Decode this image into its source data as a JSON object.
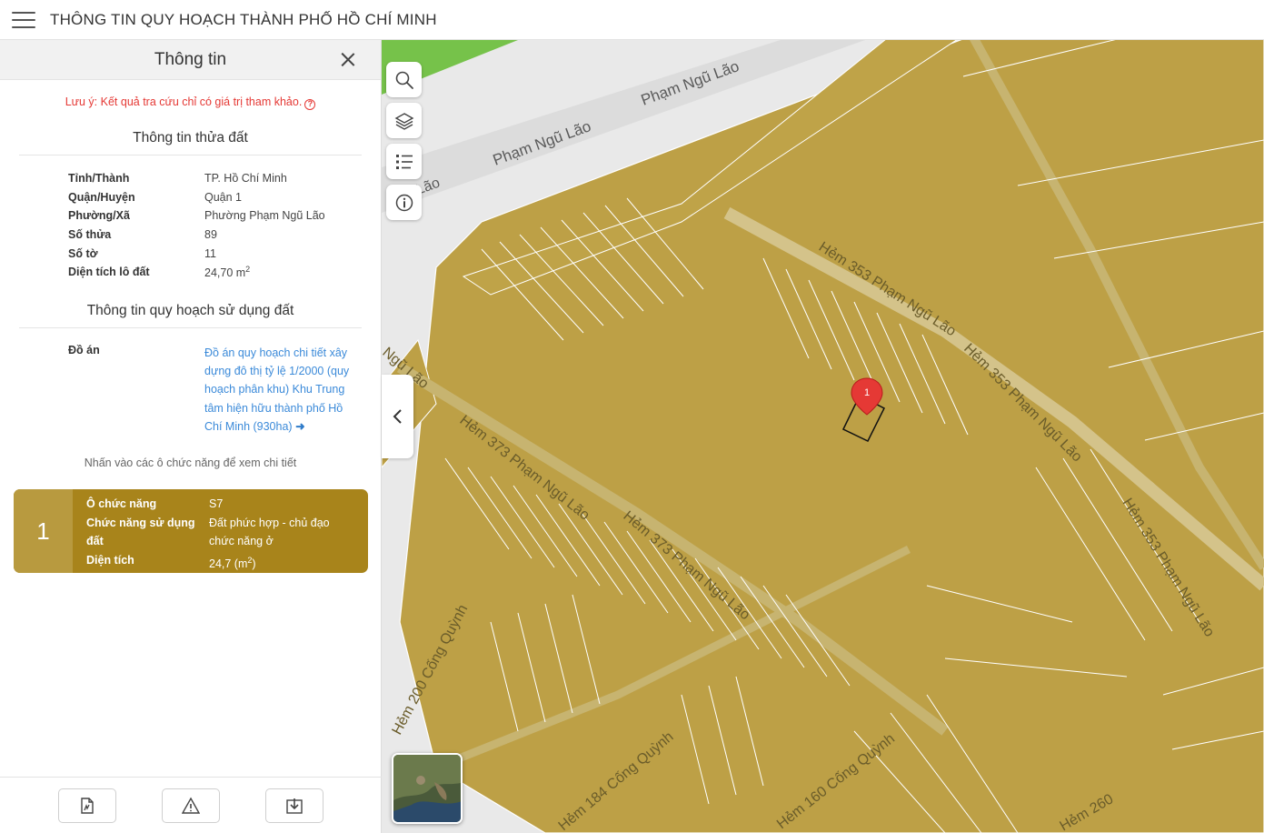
{
  "app": {
    "title": "THÔNG TIN QUY HOẠCH THÀNH PHỐ HỒ CHÍ MINH"
  },
  "panel": {
    "title": "Thông tin",
    "note": "Lưu ý: Kết quả tra cứu chỉ có giá trị tham khảo.",
    "parcel_section_title": "Thông tin thửa đất",
    "parcel_info": [
      {
        "key": "Tỉnh/Thành",
        "value": "TP. Hồ Chí Minh"
      },
      {
        "key": "Quận/Huyện",
        "value": "Quận 1"
      },
      {
        "key": "Phường/Xã",
        "value": "Phường Phạm Ngũ Lão"
      },
      {
        "key": "Số thửa",
        "value": "89"
      },
      {
        "key": "Số tờ",
        "value": "11"
      },
      {
        "key": "Diện tích lô đất",
        "value": "24,70 m",
        "sup": "2"
      }
    ],
    "plan_section_title": "Thông tin quy hoạch sử dụng đất",
    "plan_key": "Đồ án",
    "plan_value": "Đồ án quy hoạch chi tiết xây dựng đô thị tỷ lệ 1/2000 (quy hoạch phân khu) Khu Trung tâm hiện hữu thành phố Hồ Chí Minh (930ha)",
    "hint": "Nhấn vào các ô chức năng để xem chi tiết",
    "function_card": {
      "number": "1",
      "rows": [
        {
          "key": "Ô chức năng",
          "value": "S7"
        },
        {
          "key": "Chức năng sử dụng đất",
          "value": "Đất phức hợp - chủ đạo chức năng ở"
        },
        {
          "key": "Diện tích",
          "value": "24,7 (m",
          "sup": "2",
          "tail": ")"
        }
      ]
    }
  },
  "map": {
    "marker_label": "1",
    "street_labels": [
      {
        "text": "Phạm Ngũ Lão"
      },
      {
        "text": "Phạm Ngũ Lão"
      },
      {
        "text": "Hẻm 353 Phạm Ngũ Lão"
      },
      {
        "text": "Hẻm 353 Phạm Ngũ Lão"
      },
      {
        "text": "Hẻm 353 Phạm Ngũ Lão"
      },
      {
        "text": "Hẻm 373 Phạm Ngũ Lão"
      },
      {
        "text": "Hẻm 373 Phạm Ngũ Lão"
      },
      {
        "text": "Hẻm 200 Cống Quỳnh"
      },
      {
        "text": "Hẻm 160 Cống Quỳnh"
      },
      {
        "text": "Hẻm 184 Cống Quỳnh"
      },
      {
        "text": "Hẻm 260"
      },
      {
        "text": "Ngũ Lão"
      },
      {
        "text": "Lão"
      }
    ],
    "land_color": "#bda046",
    "park_color": "#76c24a",
    "road_color": "#e6e6e6"
  },
  "colors": {
    "note_red": "#e53935",
    "link_blue": "#3b8ad9",
    "card_brown": "#a8841b"
  }
}
